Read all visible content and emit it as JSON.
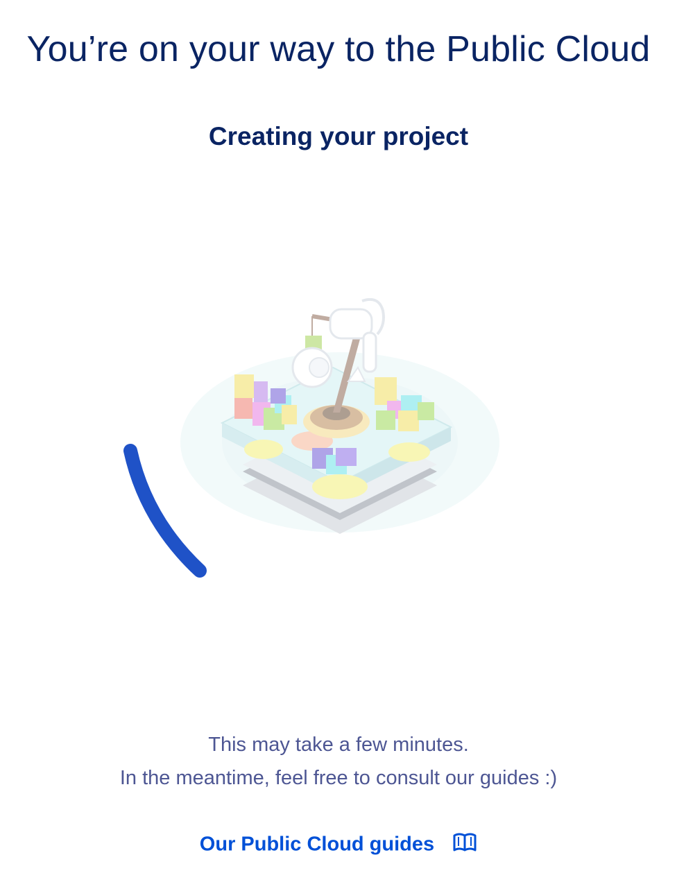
{
  "header": {
    "title": "You’re on your way to the Public Cloud",
    "subtitle": "Creating your project"
  },
  "illustration": {
    "icon": "robot-arm-data-center-illustration",
    "spinner_icon": "loading-spinner-icon",
    "spinner_color": "#1f52c7"
  },
  "message": {
    "line1": "This may take a few minutes.",
    "line2": "In the meantime, feel free to consult our guides :)"
  },
  "guides_link": {
    "label": "Our Public Cloud guides",
    "icon": "book-icon",
    "color": "#0050d7"
  },
  "colors": {
    "title": "#0a2463",
    "body_text": "#4d5693"
  }
}
